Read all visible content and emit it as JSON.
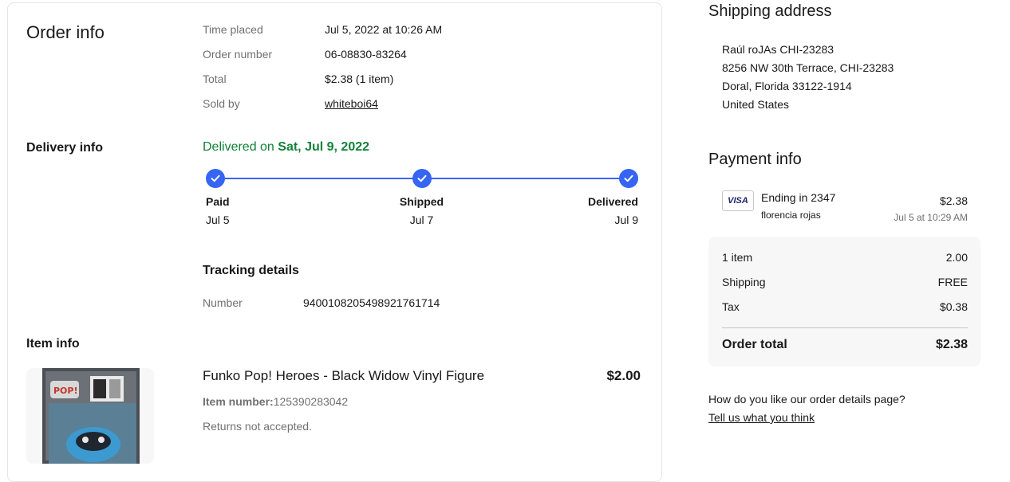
{
  "order_info": {
    "heading": "Order info",
    "time_placed_label": "Time placed",
    "time_placed_value": "Jul 5, 2022 at 10:26 AM",
    "order_number_label": "Order number",
    "order_number_value": "06-08830-83264",
    "total_label": "Total",
    "total_value": "$2.38 (1 item)",
    "sold_by_label": "Sold by",
    "sold_by_value": "whiteboi64"
  },
  "delivery_info": {
    "heading": "Delivery info",
    "status_prefix": "Delivered on",
    "status_date": "Sat, Jul 9, 2022",
    "steps": [
      {
        "name": "Paid",
        "date": "Jul 5"
      },
      {
        "name": "Shipped",
        "date": "Jul 7"
      },
      {
        "name": "Delivered",
        "date": "Jul 9"
      }
    ],
    "tracking_heading": "Tracking details",
    "tracking_number_label": "Number",
    "tracking_number_value": "9400108205498921761714"
  },
  "item_info": {
    "heading": "Item info",
    "title": "Funko Pop! Heroes - Black Widow Vinyl Figure",
    "price": "$2.00",
    "item_number_label": "Item number:",
    "item_number_value": "125390283042",
    "returns": "Returns not accepted."
  },
  "shipping_address": {
    "heading": "Shipping address",
    "lines": [
      "Raúl roJAs CHI-23283",
      "8256 NW 30th Terrace, CHI-23283",
      "Doral, Florida 33122-1914",
      "United States"
    ]
  },
  "payment_info": {
    "heading": "Payment info",
    "card_brand": "VISA",
    "card_ending": "Ending in 2347",
    "card_holder": "florencia rojas",
    "amount": "$2.38",
    "paid_time": "Jul 5 at 10:29 AM"
  },
  "summary": {
    "items_label": "1 item",
    "items_value": "2.00",
    "shipping_label": "Shipping",
    "shipping_value": "FREE",
    "tax_label": "Tax",
    "tax_value": "$0.38",
    "total_label": "Order total",
    "total_value": "$2.38"
  },
  "feedback": {
    "question": "How do you like our order details page?",
    "link": "Tell us what you think"
  },
  "colors": {
    "accent_blue": "#3665f3",
    "delivered_green": "#118238",
    "muted_text": "#707070"
  }
}
